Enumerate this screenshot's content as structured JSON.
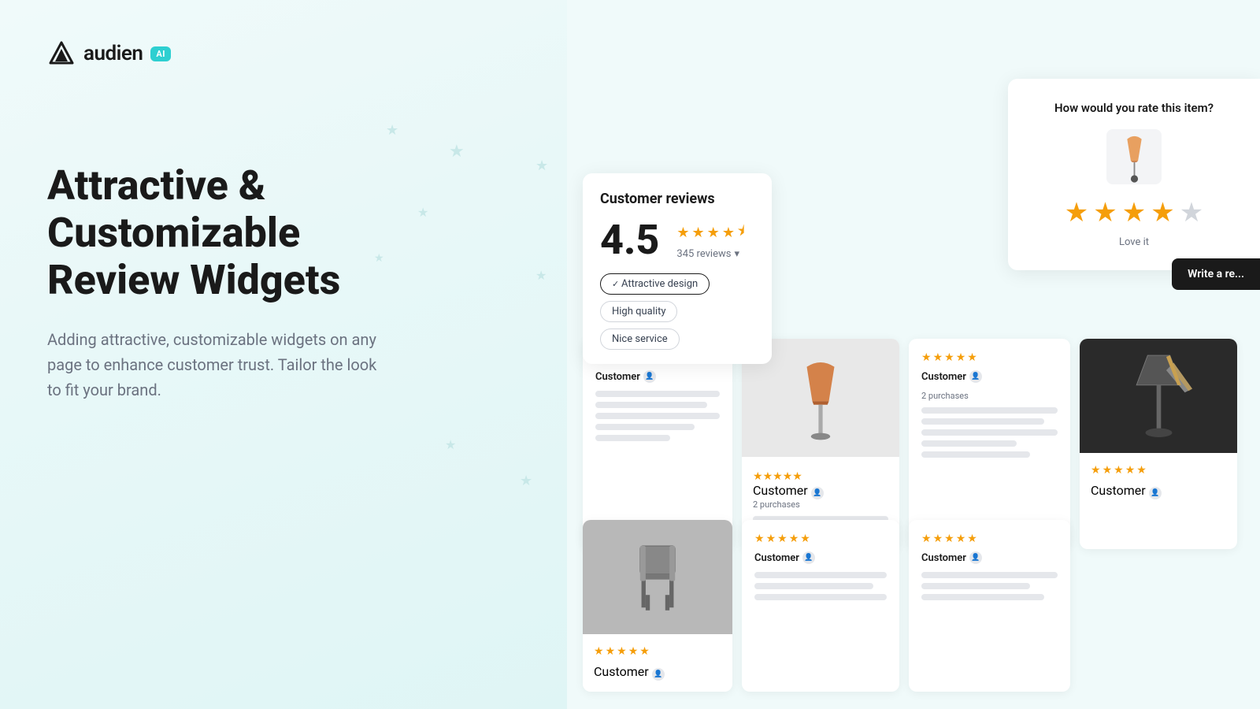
{
  "logo": {
    "text": "audien",
    "badge": "AI"
  },
  "hero": {
    "title": "Attractive & Customizable Review Widgets",
    "subtitle": "Adding attractive, customizable widgets on any page to enhance customer trust. Tailor the look to fit your brand."
  },
  "reviewWidget": {
    "title": "Customer reviews",
    "rating": "4.5",
    "reviewsCount": "345 reviews",
    "filterTags": [
      {
        "label": "Attractive design",
        "active": true
      },
      {
        "label": "High quality",
        "active": false
      },
      {
        "label": "Nice service",
        "active": false
      }
    ]
  },
  "rateWidget": {
    "title": "How would you rate this item?",
    "ratingLabel": "Love it",
    "writeReviewLabel": "Write a re..."
  },
  "reviewCards": [
    {
      "id": 1,
      "stars": 5,
      "customerName": "Customer",
      "hasImage": false
    },
    {
      "id": 2,
      "stars": 5,
      "customerName": "Customer",
      "purchases": "2 purchases",
      "hasImage": true,
      "imageType": "lamp"
    },
    {
      "id": 3,
      "stars": 5,
      "customerName": "Customer",
      "purchases": "2 purchases",
      "hasImage": false
    },
    {
      "id": 4,
      "stars": 5,
      "customerName": "Customer",
      "hasImage": true,
      "imageType": "lamp2"
    }
  ],
  "reviewCardsRow2": [
    {
      "id": 5,
      "stars": 5,
      "customerName": "Customer",
      "hasImage": true,
      "imageType": "chair"
    },
    {
      "id": 6,
      "stars": 5,
      "customerName": "Customer",
      "purchases": "",
      "hasImage": false
    },
    {
      "id": 7,
      "stars": 5,
      "customerName": "Customer",
      "purchases": "",
      "hasImage": false
    }
  ],
  "decorativeStars": [
    {
      "top": "17",
      "left": "35",
      "size": "18"
    },
    {
      "top": "25",
      "left": "60",
      "size": "22"
    },
    {
      "top": "20",
      "left": "85",
      "size": "18"
    },
    {
      "top": "38",
      "left": "48",
      "size": "16"
    },
    {
      "top": "42",
      "left": "93",
      "size": "16"
    },
    {
      "top": "52",
      "left": "30",
      "size": "14"
    },
    {
      "top": "65",
      "left": "80",
      "size": "18"
    },
    {
      "top": "70",
      "left": "47",
      "size": "14"
    },
    {
      "top": "75",
      "left": "93",
      "size": "16"
    }
  ]
}
